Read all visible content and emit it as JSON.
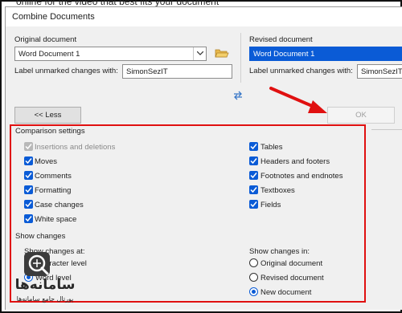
{
  "background_text": "online for the video that best fits your document",
  "dialog": {
    "title": "Combine Documents"
  },
  "original": {
    "label": "Original document",
    "value": "Word Document 1",
    "unmarked_label": "Label unmarked changes with:",
    "unmarked_value": "SimonSezIT"
  },
  "revised": {
    "label": "Revised document",
    "value": "Word Document 1",
    "unmarked_label": "Label unmarked changes with:",
    "unmarked_value": "SimonSezIT"
  },
  "buttons": {
    "less": "<< Less",
    "ok": "OK"
  },
  "comparison": {
    "title": "Comparison settings",
    "left": [
      {
        "label": "Insertions and deletions",
        "disabled": true
      },
      {
        "label": "Moves"
      },
      {
        "label": "Comments"
      },
      {
        "label": "Formatting"
      },
      {
        "label": "Case changes"
      },
      {
        "label": "White space"
      }
    ],
    "right": [
      {
        "label": "Tables"
      },
      {
        "label": "Headers and footers"
      },
      {
        "label": "Footnotes and endnotes"
      },
      {
        "label": "Textboxes"
      },
      {
        "label": "Fields"
      }
    ]
  },
  "show_changes": {
    "title": "Show changes",
    "at_label": "Show changes at:",
    "at_options": [
      "Character level",
      "Word level"
    ],
    "in_label": "Show changes in:",
    "in_options": [
      "Original document",
      "Revised document",
      "New document"
    ],
    "in_selected": 2
  },
  "watermark": {
    "name": "سامانه‌ها",
    "tagline": "پورتال جامع سامانه‌ها"
  },
  "colors": {
    "accent": "#0a5bd6",
    "highlight_box": "#e01010",
    "arrow": "#e01010"
  }
}
